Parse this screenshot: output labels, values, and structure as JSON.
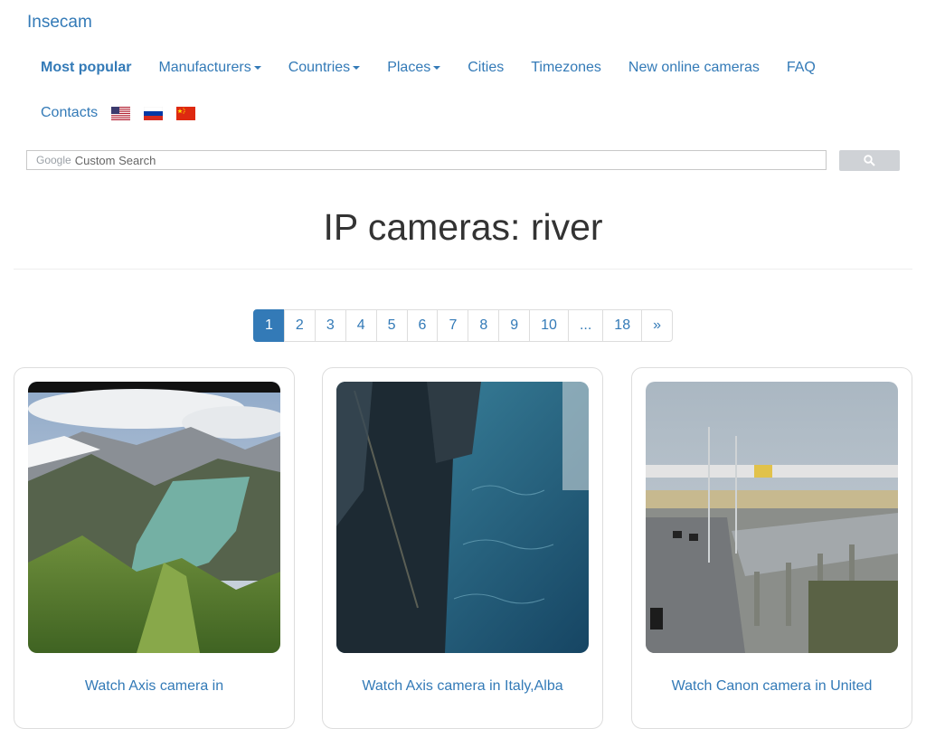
{
  "brand": "Insecam",
  "nav": {
    "most_popular": "Most popular",
    "manufacturers": "Manufacturers",
    "countries": "Countries",
    "places": "Places",
    "cities": "Cities",
    "timezones": "Timezones",
    "new_online": "New online cameras",
    "faq": "FAQ",
    "contacts": "Contacts",
    "flags": [
      "us-flag-icon",
      "russia-flag-icon",
      "china-flag-icon"
    ]
  },
  "search": {
    "google_label": "Google",
    "placeholder": "Custom Search",
    "button_icon": "search-icon"
  },
  "title": "IP cameras: river",
  "pagination": {
    "pages": [
      "1",
      "2",
      "3",
      "4",
      "5",
      "6",
      "7",
      "8",
      "9",
      "10",
      "...",
      "18",
      "»"
    ],
    "current": "1"
  },
  "cameras": [
    {
      "title": "Watch Axis camera in"
    },
    {
      "title": "Watch Axis camera in Italy,Alba"
    },
    {
      "title": "Watch Canon camera in United"
    }
  ],
  "colors": {
    "link": "#337ab7",
    "active_page": "#337ab7",
    "border": "#dddddd"
  }
}
